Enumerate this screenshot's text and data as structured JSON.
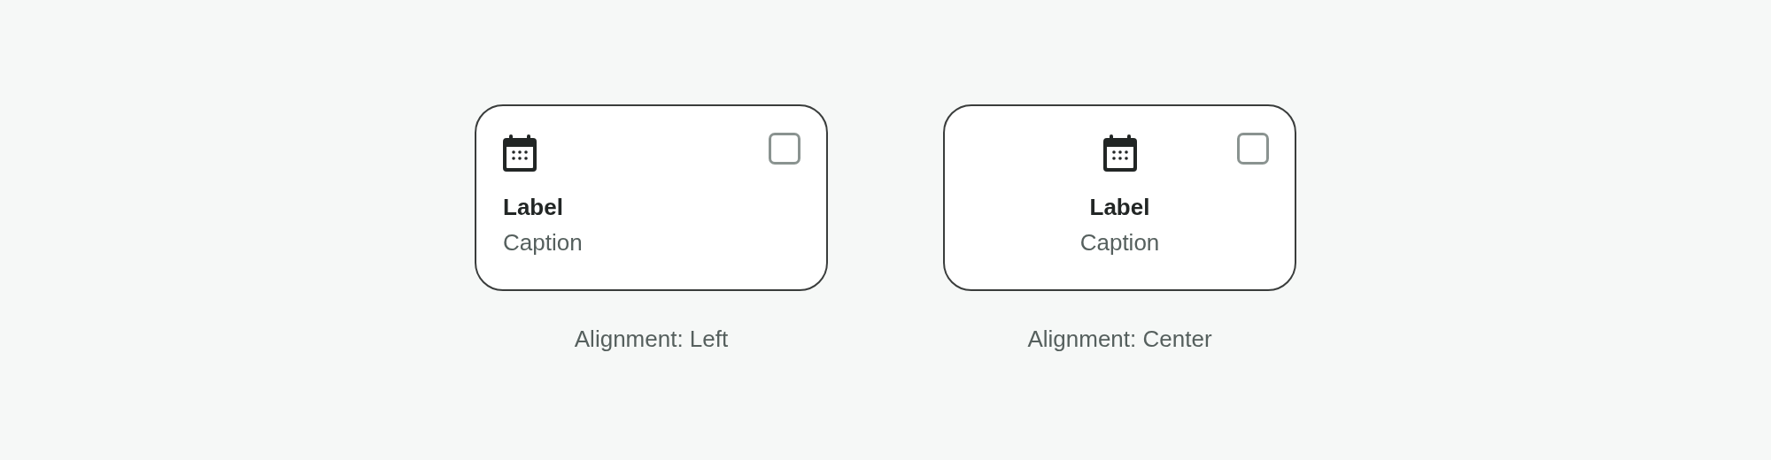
{
  "variants": [
    {
      "kind": "left",
      "label": "Label",
      "caption": "Caption",
      "checked": false,
      "description": "Alignment: Left"
    },
    {
      "kind": "center",
      "label": "Label",
      "caption": "Caption",
      "checked": false,
      "description": "Alignment: Center"
    }
  ]
}
